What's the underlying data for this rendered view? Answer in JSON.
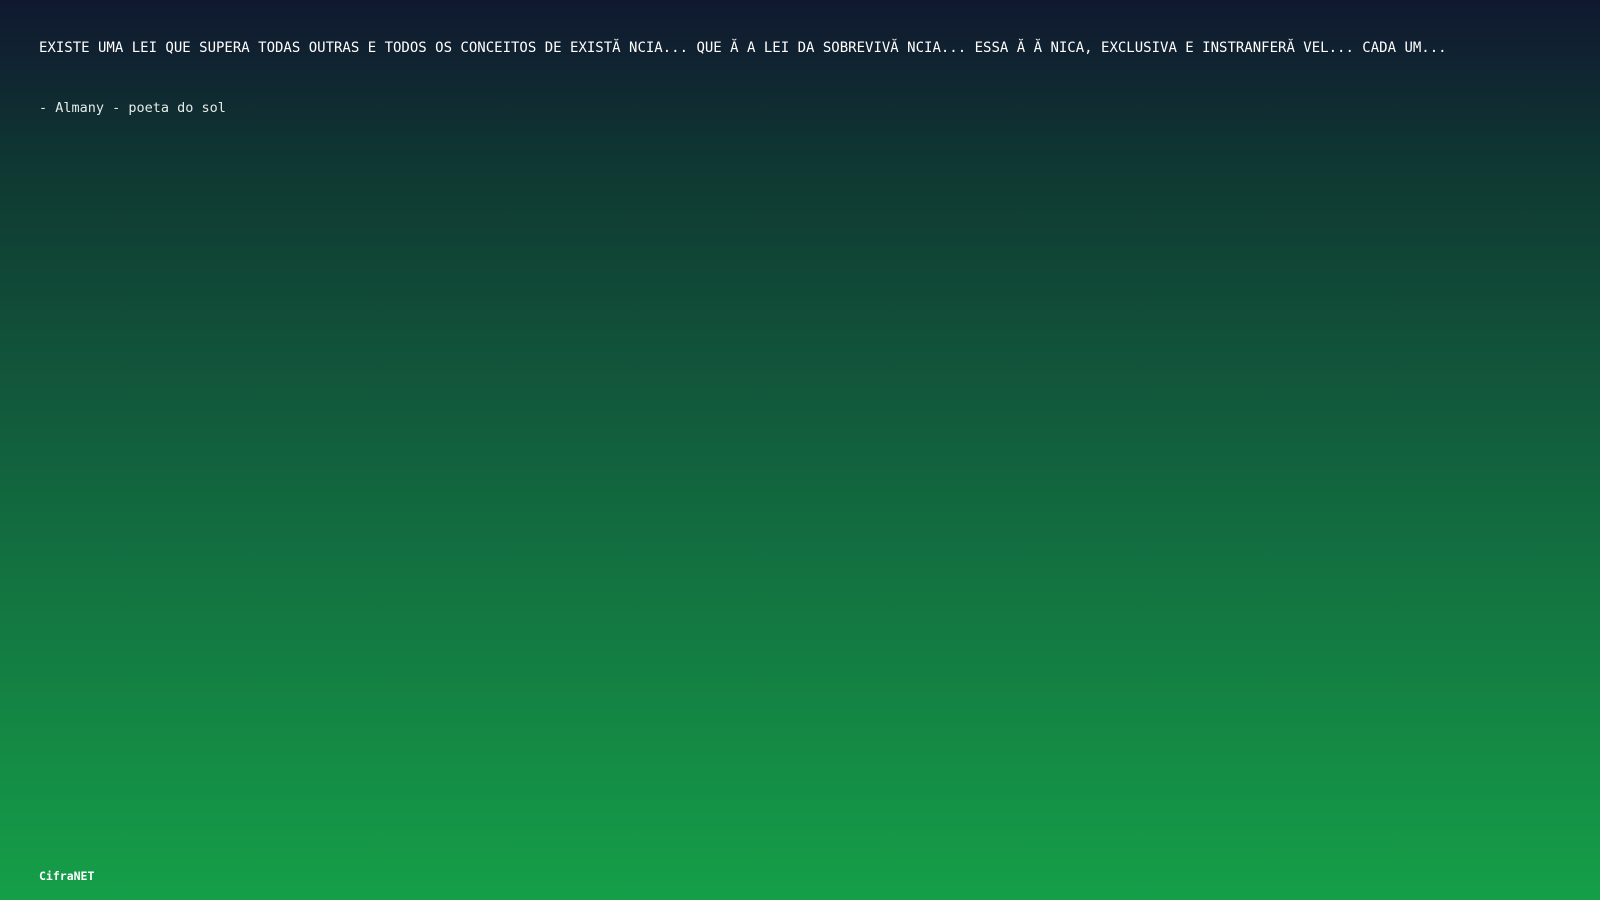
{
  "quote": {
    "text": "EXISTE UMA LEI QUE SUPERA TODAS OUTRAS E TODOS OS CONCEITOS DE EXISTĂ NCIA... QUE Ă  A LEI DA SOBREVIVĂ NCIA... ESSA Ă  Ă NICA, EXCLUSIVA E INSTRANFERĂ VEL... CADA UM...",
    "author": "- Almany - poeta do sol"
  },
  "footer": {
    "brand": "CifraNET"
  },
  "colors": {
    "gradient_top": "#101830",
    "gradient_bottom": "#159f48",
    "text": "#ffffff"
  }
}
